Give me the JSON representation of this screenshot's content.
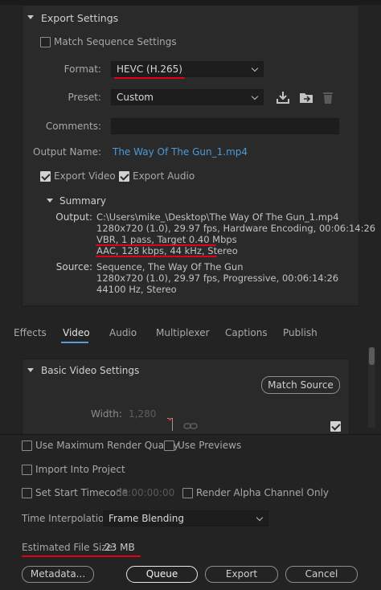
{
  "export_settings": {
    "section_title": "Export Settings",
    "match_sequence_label": "Match Sequence Settings",
    "match_sequence_checked": false,
    "format_label": "Format:",
    "format_value": "HEVC (H.265)",
    "preset_label": "Preset:",
    "preset_value": "Custom",
    "comments_label": "Comments:",
    "comments_value": "",
    "output_name_label": "Output Name:",
    "output_name_value": "The Way Of The Gun_1.mp4",
    "export_video_label": "Export Video",
    "export_video_checked": true,
    "export_audio_label": "Export Audio",
    "export_audio_checked": true,
    "icons": [
      "save-preset-icon",
      "import-preset-icon",
      "delete-preset-icon"
    ]
  },
  "summary": {
    "title": "Summary",
    "output_label": "Output:",
    "output_lines": [
      "C:\\Users\\mike_\\Desktop\\The Way Of The Gun_1.mp4",
      "1280x720 (1.0), 29.97 fps, Hardware Encoding, 00:06:14:26",
      "VBR, 1 pass, Target 0.40 Mbps",
      "AAC, 128 kbps, 44 kHz, Stereo"
    ],
    "source_label": "Source:",
    "source_lines": [
      "Sequence, The Way Of The Gun",
      "1280x720 (1.0), 29.97 fps, Progressive, 00:06:14:26",
      "44100 Hz, Stereo"
    ]
  },
  "tabs": {
    "items": [
      "Effects",
      "Video",
      "Audio",
      "Multiplexer",
      "Captions",
      "Publish"
    ],
    "active": "Video"
  },
  "video_settings": {
    "section_title": "Basic Video Settings",
    "match_source_label": "Match Source",
    "width_label": "Width:",
    "width_value": "1,280",
    "linked": true
  },
  "bottom": {
    "max_render_quality_label": "Use Maximum Render Quality",
    "max_render_quality_checked": false,
    "use_previews_label": "Use Previews",
    "use_previews_checked": false,
    "import_into_project_label": "Import Into Project",
    "import_into_project_checked": false,
    "set_start_timecode_label": "Set Start Timecode",
    "set_start_timecode_checked": false,
    "timecode_value": "00:00:00:00",
    "render_alpha_label": "Render Alpha Channel Only",
    "render_alpha_checked": false,
    "time_interpolation_label": "Time Interpolation:",
    "time_interpolation_value": "Frame Blending",
    "estimated_size_label": "Estimated File Size:",
    "estimated_size_value": "23 MB"
  },
  "buttons": {
    "metadata": "Metadata...",
    "queue": "Queue",
    "export": "Export",
    "cancel": "Cancel"
  },
  "colors": {
    "background": "#232323",
    "panel": "#2a2a2a",
    "link": "#4d9ad8",
    "annotation_red": "#e2001a"
  }
}
